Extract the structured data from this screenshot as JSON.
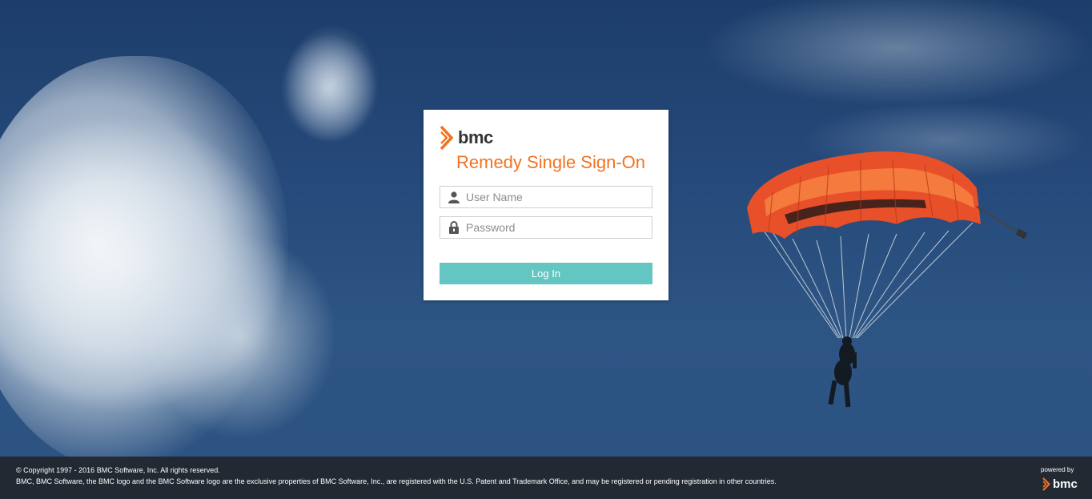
{
  "brand": {
    "name": "bmc",
    "accent_color": "#f17321"
  },
  "login": {
    "title": "Remedy Single Sign-On",
    "username": {
      "placeholder": "User Name",
      "value": "",
      "icon": "user-icon"
    },
    "password": {
      "placeholder": "Password",
      "value": "",
      "icon": "lock-icon"
    },
    "button_label": "Log In",
    "button_color": "#63c6c2"
  },
  "footer": {
    "copyright": "© Copyright 1997 - 2016 BMC Software, Inc. All rights reserved.",
    "trademark": "BMC, BMC Software, the BMC logo and the BMC Software logo are the exclusive properties of BMC Software, Inc., are registered with the U.S. Patent and Trademark Office, and may be registered or pending registration in other countries.",
    "powered_by": "powered by",
    "brand_name": "bmc"
  }
}
